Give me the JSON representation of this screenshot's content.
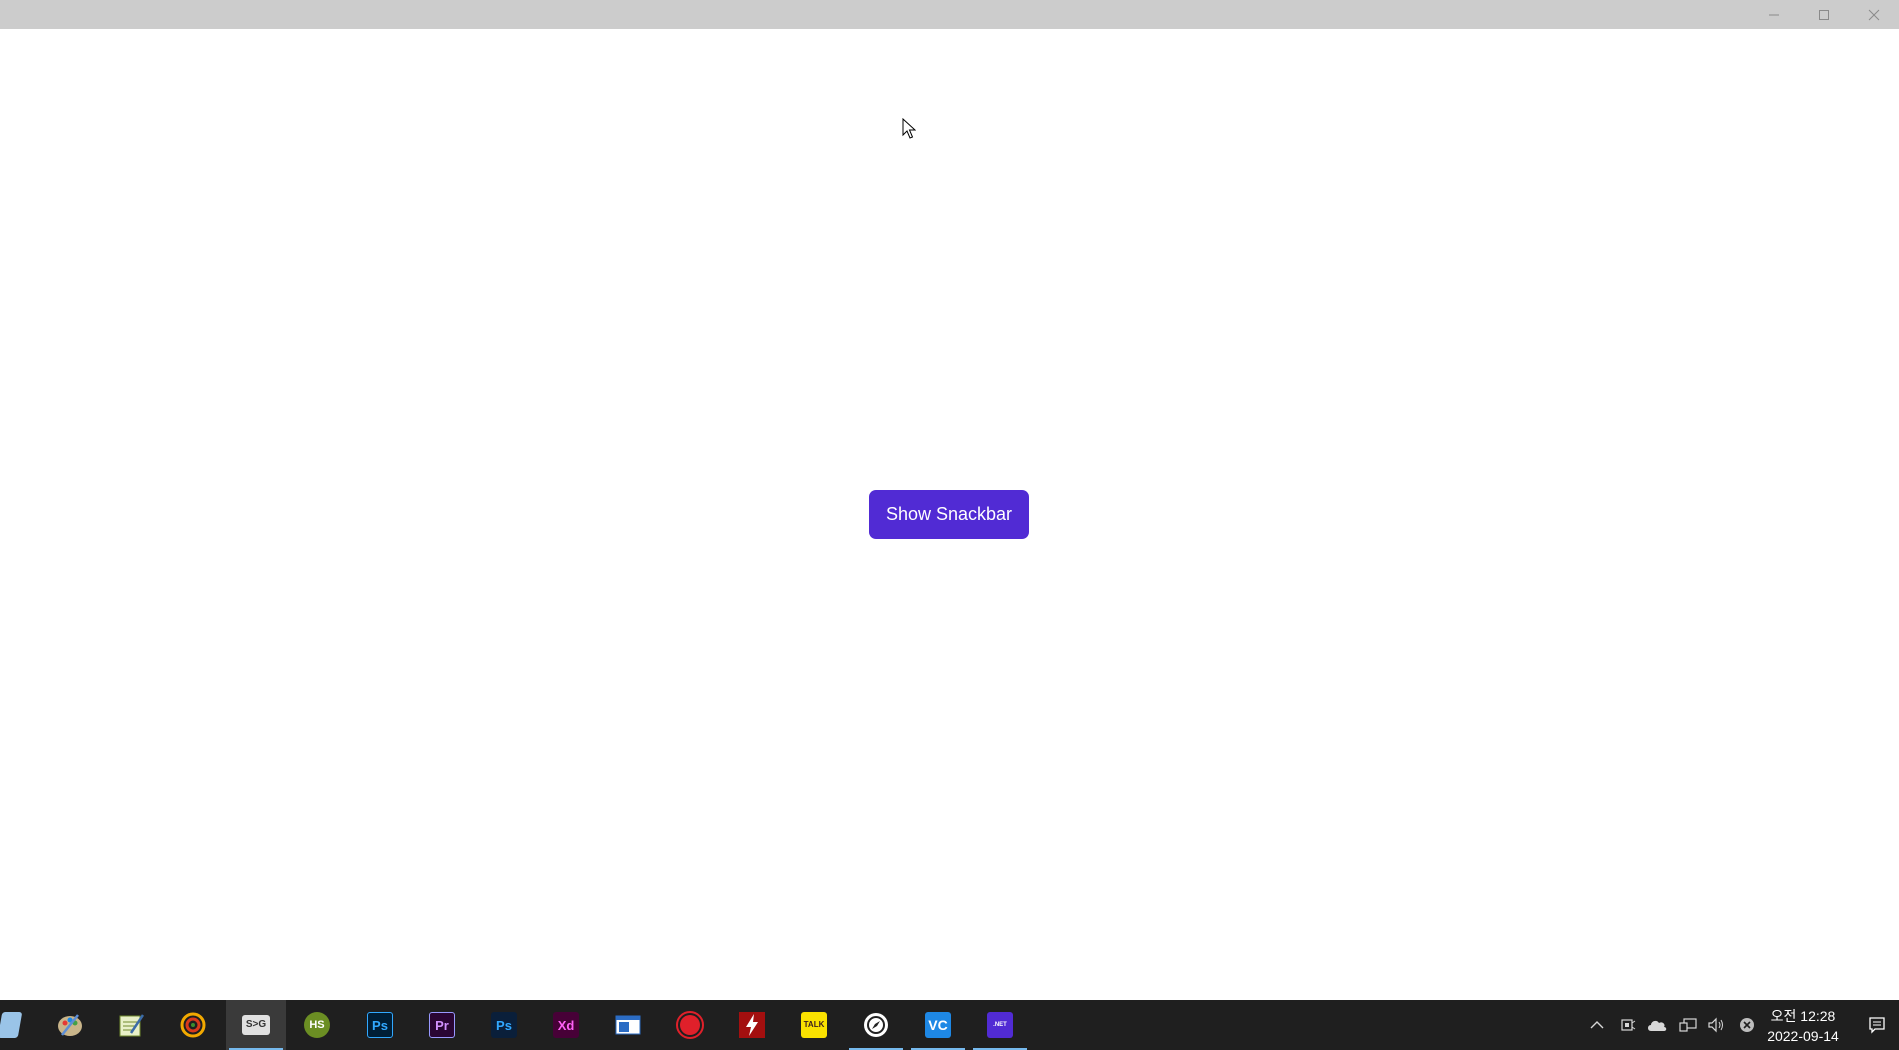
{
  "window": {
    "title": "",
    "controls": [
      "minimize-icon",
      "maximize-icon",
      "close-icon"
    ]
  },
  "main": {
    "button_label": "Show Snackbar",
    "button_color": "#512bd4"
  },
  "taskbar": {
    "apps": [
      {
        "name": "file-app",
        "label": ""
      },
      {
        "name": "paint-app",
        "label": ""
      },
      {
        "name": "notepad-app",
        "label": ""
      },
      {
        "name": "chameleon-app",
        "label": ""
      },
      {
        "name": "cmd-app",
        "label": "S>G"
      },
      {
        "name": "hs-app",
        "label": "HS"
      },
      {
        "name": "photoshop-app",
        "label": "Ps"
      },
      {
        "name": "premiere-app",
        "label": "Pr"
      },
      {
        "name": "photoshop-app-2",
        "label": "Ps"
      },
      {
        "name": "xd-app",
        "label": "Xd"
      },
      {
        "name": "window-app",
        "label": ""
      },
      {
        "name": "record-app",
        "label": ""
      },
      {
        "name": "flash-app",
        "label": ""
      },
      {
        "name": "kakaotalk-app",
        "label": "TALK"
      },
      {
        "name": "compass-app",
        "label": ""
      },
      {
        "name": "vscode-app",
        "label": "VC"
      },
      {
        "name": "dotnet-app",
        "label": ".NET"
      }
    ],
    "tray_icons": [
      "chevron-up-icon",
      "meet-icon",
      "onedrive-icon",
      "network-icon",
      "volume-icon",
      "close-circle-icon"
    ],
    "clock": {
      "time": "오전 12:28",
      "date": "2022-09-14"
    }
  }
}
